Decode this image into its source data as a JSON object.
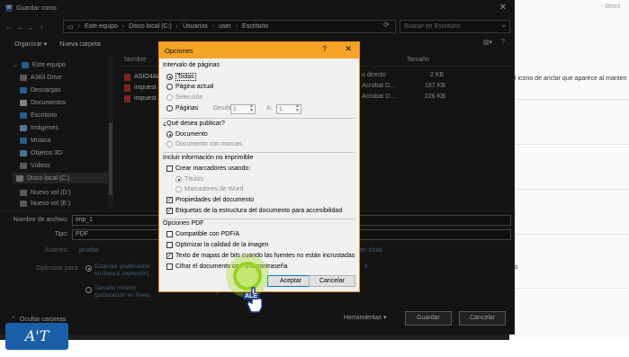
{
  "background": {
    "app_name": "- Word",
    "hint": "l icono de anclar que aparece al manten",
    "hint2": "s"
  },
  "window": {
    "title": "Guardar como"
  },
  "address": {
    "parts": [
      "Este equipo",
      "Disco local (C:)",
      "Usuarios",
      "user",
      "Escritorio"
    ],
    "search_placeholder": "Buscar en Escritorio"
  },
  "toolbar": {
    "organize": "Organizar ▾",
    "new_folder": "Nueva carpeta"
  },
  "sidebar": {
    "items": [
      "Este equipo",
      "A360 Drive",
      "Descargas",
      "Documentos",
      "Escritorio",
      "Imágenes",
      "Música",
      "Objetos 3D",
      "Vídeos",
      "Disco local (C:)",
      "Nuevo vol (D:)",
      "Nuevo vol (E:)"
    ]
  },
  "filelist": {
    "col_name": "Nombre",
    "col_size": "Tamaño",
    "files": [
      {
        "name": "ASIO4AL",
        "type": "o directo",
        "size": "2 KB"
      },
      {
        "name": "impuest",
        "type": "Acrobat D...",
        "size": "187 KB"
      },
      {
        "name": "impuest",
        "type": "Acrobat D...",
        "size": "226 KB"
      }
    ]
  },
  "bottom": {
    "filename_label": "Nombre de archivo:",
    "filename_value": "imp_1",
    "type_label": "Tipo:",
    "type_value": "PDF",
    "authors_label": "Autores:",
    "authors_value": "prueba",
    "optimize_label": "Optimizar para:",
    "opt1": "Estándar (publicación en línea e impresión)",
    "opt2": "Tamaño mínimo (publicación en línea)",
    "tags_label": "en título",
    "tools": "Herramientas",
    "save": "Guardar",
    "cancel": "Cancelar",
    "hide_folders": "Ocultar carpetas"
  },
  "dialog": {
    "title": "Opciones",
    "help": "?",
    "close": "✕",
    "page_range": "Intervalo de páginas",
    "all": "Todas",
    "current": "Página actual",
    "selection": "Selección",
    "pages": "Páginas",
    "from_label": "Desde:",
    "from_value": "1",
    "to_label": "A:",
    "to_value": "1",
    "publish_q": "¿Qué desea publicar?",
    "document": "Documento",
    "doc_markup": "Documento con marcas",
    "non_print": "Incluir información no imprimible",
    "create_bookmarks": "Crear marcadores usando:",
    "headings": "Títulos",
    "word_bookmarks": "Marcadores de Word",
    "doc_props": "Propiedades del documento",
    "struct_tags": "Etiquetas de la estructura del documento para accesibilidad",
    "pdf_options": "Opciones PDF",
    "pdfa": "Compatible con PDF/A",
    "optimize_img": "Optimizar la calidad de la imagen",
    "bitmap_text": "Texto de mapas de bits cuando las fuentes no están incrustadas",
    "encrypt": "Cifrar el documento con una contraseña",
    "accept": "Aceptar",
    "cancel": "Cancelar"
  },
  "watermark": {
    "logo_text": "A'T",
    "cursor_label": "ALE"
  }
}
